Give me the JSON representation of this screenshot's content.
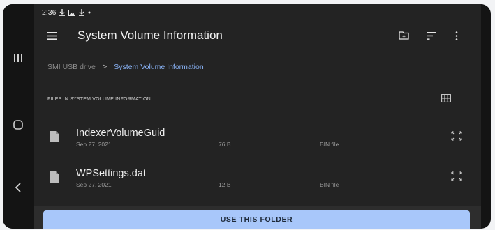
{
  "status_bar": {
    "time": "2:36",
    "icons": [
      "download-icon",
      "image-icon",
      "download-icon",
      "dot-icon"
    ]
  },
  "nav_bar": {
    "icons": [
      "recents-icon",
      "home-icon",
      "back-icon"
    ]
  },
  "toolbar": {
    "title": "System Volume Information",
    "icons": [
      "menu-icon",
      "new-folder-icon",
      "sort-icon",
      "more-vert-icon"
    ]
  },
  "breadcrumb": {
    "root": "SMI USB drive",
    "separator": ">",
    "current": "System Volume Information"
  },
  "section": {
    "header": "FILES IN SYSTEM VOLUME INFORMATION"
  },
  "files": [
    {
      "name": "IndexerVolumeGuid",
      "date": "Sep 27, 2021",
      "size": "76 B",
      "type": "BIN file"
    },
    {
      "name": "WPSettings.dat",
      "date": "Sep 27, 2021",
      "size": "12 B",
      "type": "BIN file"
    }
  ],
  "action": {
    "use_folder_label": "USE THIS FOLDER"
  },
  "colors": {
    "background": "#232323",
    "accent": "#a8c7fa",
    "breadcrumb_active": "#8ab4f8"
  }
}
